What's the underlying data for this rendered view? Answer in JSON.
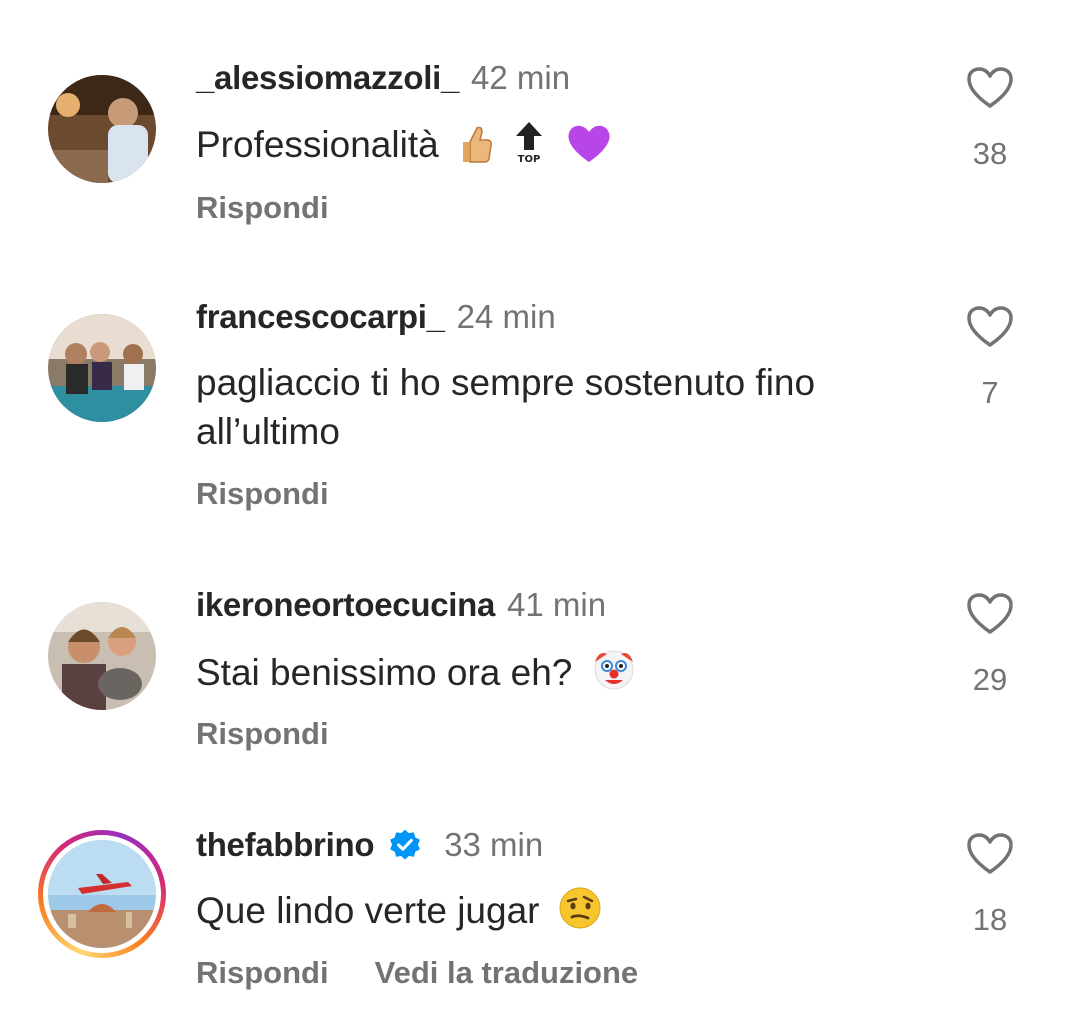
{
  "comments": [
    {
      "username": "_alessiomazzoli_",
      "time": "42 min",
      "text": "Professionalità",
      "emojis": [
        "thumbs-up",
        "top-arrow",
        "purple-heart"
      ],
      "likes": "38",
      "reply_label": "Rispondi",
      "verified": false
    },
    {
      "username": "francescocarpi_",
      "time": "24 min",
      "text": "pagliaccio ti ho sempre sostenuto fino all’ultimo",
      "emojis": [],
      "likes": "7",
      "reply_label": "Rispondi",
      "verified": false
    },
    {
      "username": "ikeroneortoecucina",
      "time": "41 min",
      "text": "Stai benissimo ora eh?",
      "emojis": [
        "clown-face"
      ],
      "likes": "29",
      "reply_label": "Rispondi",
      "verified": false
    },
    {
      "username": "thefabbrino",
      "time": "33 min",
      "text": "Que lindo verte jugar",
      "emojis": [
        "confused-face"
      ],
      "likes": "18",
      "reply_label": "Rispondi",
      "translate_label": "Vedi la traduzione",
      "verified": true,
      "story_ring": true
    }
  ],
  "colors": {
    "text": "#262626",
    "secondary": "#737373",
    "verified": "#0095f6"
  }
}
